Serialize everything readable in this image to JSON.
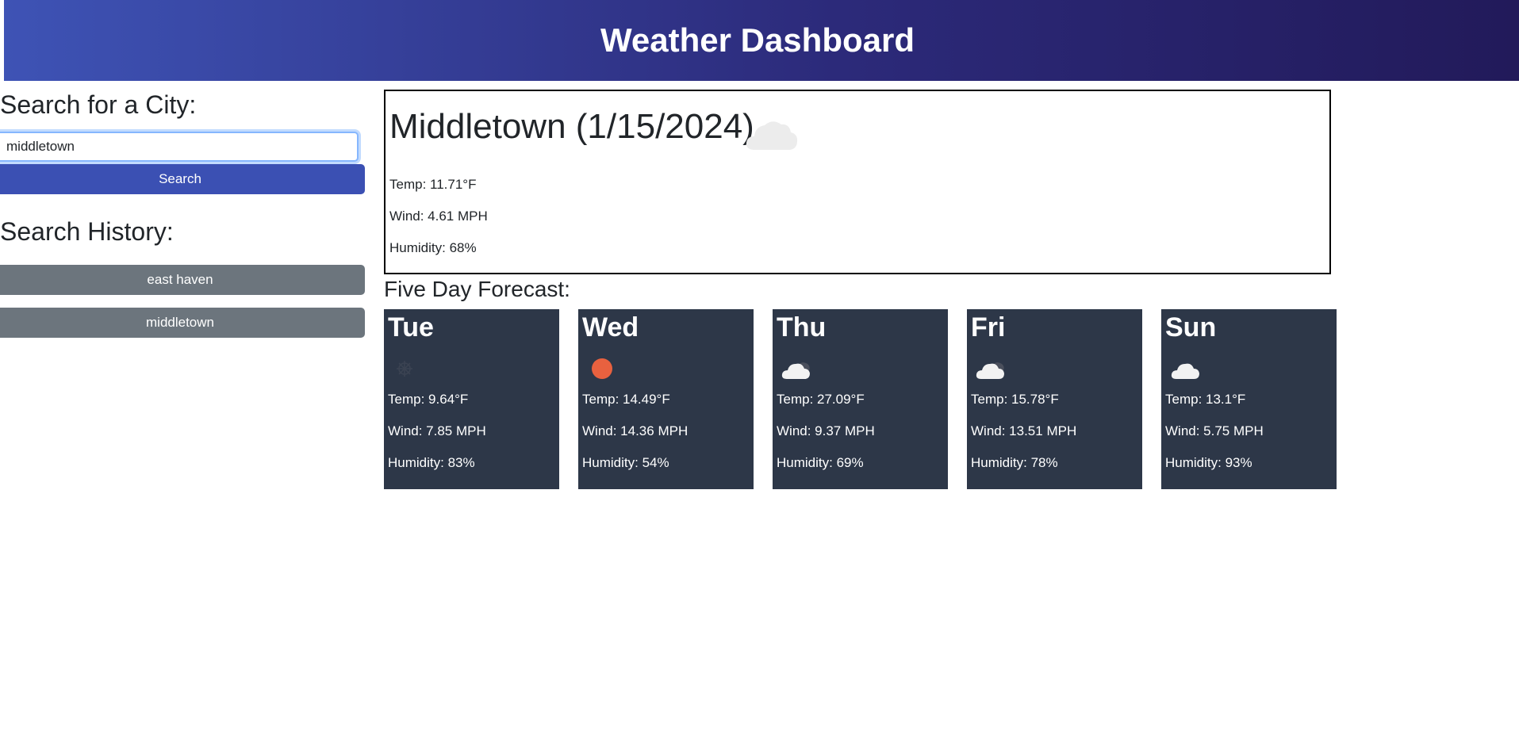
{
  "header": {
    "title": "Weather Dashboard"
  },
  "sidebar": {
    "search_title": "Search for a City:",
    "search_value": "middletown",
    "search_button": "Search",
    "history_title": "Search History:",
    "history": [
      "east haven",
      "middletown"
    ]
  },
  "current": {
    "title": "Middletown (1/15/2024)",
    "icon": "cloud-icon",
    "temp": "Temp: 11.71°F",
    "wind": "Wind: 4.61 MPH",
    "humidity": "Humidity: 68%"
  },
  "forecast": {
    "title": "Five Day Forecast:",
    "days": [
      {
        "day": "Tue",
        "icon": "snow-icon",
        "temp": "Temp: 9.64°F",
        "wind": "Wind: 7.85 MPH",
        "humidity": "Humidity: 83%"
      },
      {
        "day": "Wed",
        "icon": "sun-icon",
        "temp": "Temp: 14.49°F",
        "wind": "Wind: 14.36 MPH",
        "humidity": "Humidity: 54%"
      },
      {
        "day": "Thu",
        "icon": "partly-cloudy-icon",
        "temp": "Temp: 27.09°F",
        "wind": "Wind: 9.37 MPH",
        "humidity": "Humidity: 69%"
      },
      {
        "day": "Fri",
        "icon": "partly-cloudy-icon",
        "temp": "Temp: 15.78°F",
        "wind": "Wind: 13.51 MPH",
        "humidity": "Humidity: 78%"
      },
      {
        "day": "Sun",
        "icon": "cloud-icon",
        "temp": "Temp: 13.1°F",
        "wind": "Wind: 5.75 MPH",
        "humidity": "Humidity: 93%"
      }
    ]
  },
  "colors": {
    "header_start": "#3e53b5",
    "header_end": "#221a5a",
    "search_button": "#3b50b3",
    "history_button": "#6c757d",
    "card_background": "#2d3748",
    "sun": "#e8613f"
  }
}
